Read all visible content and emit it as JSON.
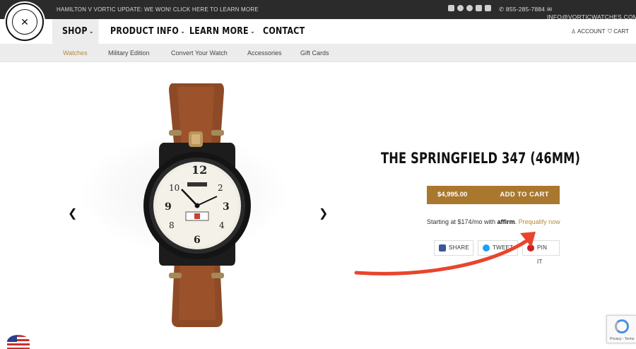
{
  "topbar": {
    "announcement": "HAMILTON V VORTIC UPDATE: WE WON! CLICK HERE TO LEARN MORE",
    "phone": "855-285-7884",
    "email": "INFO@VORTICWATCHES.COM",
    "social_icons": [
      "facebook-icon",
      "instagram-icon",
      "pinterest-icon",
      "twitter-icon",
      "youtube-icon"
    ]
  },
  "nav": {
    "shop": "SHOP",
    "product_info": "PRODUCT INFO",
    "learn_more": "LEARN MORE",
    "contact": "CONTACT",
    "account": "ACCOUNT",
    "cart": "CART"
  },
  "subnav": {
    "items": [
      "Watches",
      "Military Edition",
      "Convert Your Watch",
      "Accessories",
      "Gift Cards"
    ]
  },
  "product": {
    "title": "THE SPRINGFIELD 347 (46MM)",
    "price": "$4,995.00",
    "add_to_cart": "ADD TO CART",
    "affirm_prefix": "Starting at $174/mo with",
    "affirm_brand": "affirm",
    "affirm_link": "Prequalify now"
  },
  "share": {
    "facebook": "SHARE",
    "twitter": "TWEET",
    "pinterest": "PIN IT"
  },
  "recaptcha": {
    "footer": "Privacy - Terms"
  },
  "colors": {
    "accent": "#a9782e",
    "link": "#b58a3c",
    "annotation_arrow": "#e8452c"
  }
}
